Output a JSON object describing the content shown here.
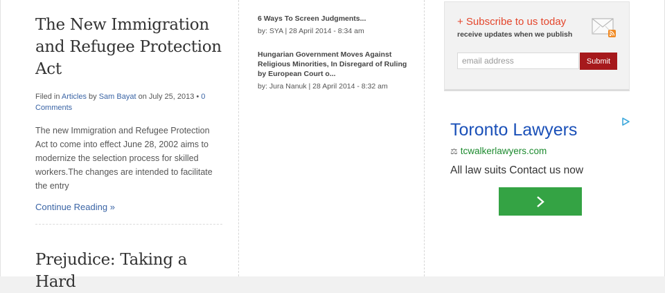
{
  "main": {
    "article1": {
      "title": "The New Immigration and Refugee Protection Act",
      "meta_filed_in": "Filed in ",
      "category": "Articles",
      "meta_by": " by ",
      "author": "Sam Bayat",
      "meta_on": " on July 25, 2013 • ",
      "comments": "0 Comments",
      "excerpt": "The new Immigration and Refugee Protection Act to come into effect June 28, 2002 aims to modernize the selection process for skilled workers.The changes are intended to facilitate the entry",
      "continue": "Continue Reading »"
    },
    "article2": {
      "title": "Prejudice: Taking a Hard"
    }
  },
  "middle": {
    "posts": [
      {
        "title": "6 Ways To Screen Judgments...",
        "meta": "by: SYA | 28 April 2014 - 8:34 am"
      },
      {
        "title": "Hungarian Government Moves Against Religious Minorities, In Disregard of Ruling by European Court o...",
        "meta": "by: Jura Nanuk | 28 April 2014 - 8:32 am"
      }
    ]
  },
  "sidebar": {
    "subscribe": {
      "title": "+ Subscribe to us today",
      "description": "receive updates when we publish",
      "placeholder": "email address",
      "submit": "Submit",
      "icon": "email-rss-icon"
    },
    "ad": {
      "title": "Toronto Lawyers",
      "url_icon": "scales-icon",
      "url": "tcwalkerlawyers.com",
      "description": "All law suits Contact us now",
      "choices_icon": "ad-choices-icon",
      "button_icon": "chevron-right-icon",
      "title_color": "#1a50b8",
      "url_color": "#1c8a2e",
      "button_color": "#34a344"
    }
  },
  "colors": {
    "link": "#3a64a5",
    "subscribe_title": "#e4452b",
    "submit_bg": "#a6191c"
  }
}
